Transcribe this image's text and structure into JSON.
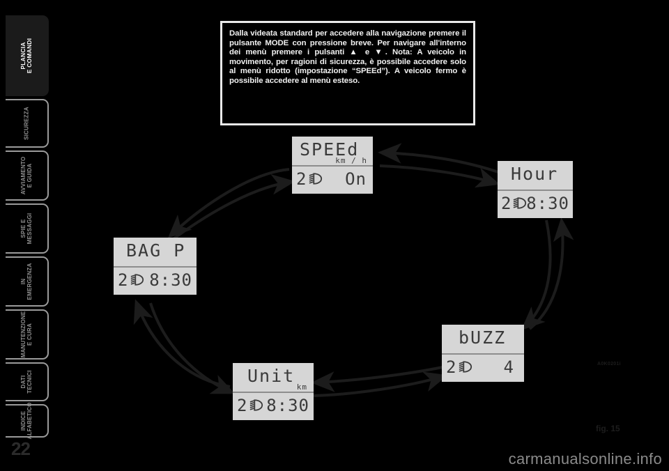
{
  "page": {
    "number": "22",
    "figure_label": "fig. 15",
    "figure_code": "A0K0201i",
    "watermark": "carmanualsonline.info"
  },
  "sidebar": {
    "tabs": [
      {
        "label": "PLANCIA\nE COMANDI",
        "active": true
      },
      {
        "label": "SICUREZZA",
        "active": false
      },
      {
        "label": "AVVIAMENTO\nE GUIDA",
        "active": false
      },
      {
        "label": "SPIE E\nMESSAGGI",
        "active": false
      },
      {
        "label": "IN\nEMERGENZA",
        "active": false
      },
      {
        "label": "MANUTENZIONE\nE CURA",
        "active": false
      },
      {
        "label": "DATI\nTECNICI",
        "active": false
      },
      {
        "label": "INDICE\nALFABETICO",
        "active": false
      }
    ]
  },
  "note": {
    "text": "Dalla videata standard per accedere alla navigazione premere il pulsante MODE con pressione breve. Per navigare all'interno dei menù premere i pulsanti ▲ e ▼. Nota: A veicolo in movimento, per ragioni di sicurezza, è possibile accedere solo al menù ridotto (impostazione “SPEEd”). A veicolo fermo è possibile accedere al menù esteso."
  },
  "displays": [
    {
      "id": "speed",
      "title": "SPEEd",
      "unit": "km / h",
      "left_value": "2",
      "right_value": "On",
      "icon": "headlight-icon"
    },
    {
      "id": "hour",
      "title": "Hour",
      "unit": "",
      "left_value": "2",
      "right_value": "8:30",
      "icon": "headlight-icon"
    },
    {
      "id": "buzz",
      "title": "bUZZ",
      "unit": "",
      "left_value": "2",
      "right_value": "4",
      "icon": "headlight-icon"
    },
    {
      "id": "unit",
      "title": "Unit",
      "unit": "km",
      "left_value": "2",
      "right_value": "8:30",
      "icon": "headlight-icon"
    },
    {
      "id": "bagp",
      "title": "BAG P",
      "unit": "",
      "left_value": "2",
      "right_value": "8:30",
      "icon": "headlight-icon"
    }
  ],
  "colors": {
    "lcd_background": "#d6d6d6",
    "lcd_text": "#3a3a3a",
    "page_background": "#000000",
    "note_border": "#e9e9e9",
    "arrow": "#1c1c1c"
  }
}
